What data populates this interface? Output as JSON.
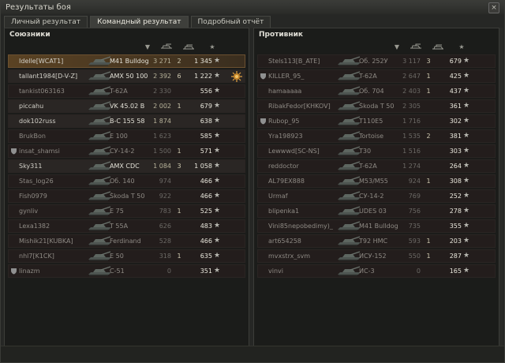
{
  "window": {
    "title": "Результаты боя",
    "close_label": "×"
  },
  "tabs": [
    {
      "label": "Личный результат"
    },
    {
      "label": "Командный результат"
    },
    {
      "label": "Подробный отчёт"
    }
  ],
  "allies": {
    "title": "Союзники",
    "rows": [
      {
        "name": "Idelle[WCAT1]",
        "tank": "M41 Bulldog",
        "damage": "3 271",
        "kills": "2",
        "xp": "1 345",
        "state": "me",
        "platoon": false
      },
      {
        "name": "tallant1984[D-V-Z]",
        "tank": "AMX 50 100",
        "damage": "2 392",
        "kills": "6",
        "xp": "1 222",
        "state": "alive",
        "platoon": false,
        "medal": true
      },
      {
        "name": "tankist063163",
        "tank": "T-62A",
        "damage": "2 330",
        "kills": "",
        "xp": "556",
        "state": "dead",
        "platoon": false
      },
      {
        "name": "piccahu",
        "tank": "VK 45.02 B",
        "damage": "2 002",
        "kills": "1",
        "xp": "679",
        "state": "alive",
        "platoon": false
      },
      {
        "name": "dok102russ",
        "tank": "B-C 155 58",
        "damage": "1 874",
        "kills": "",
        "xp": "638",
        "state": "alive",
        "platoon": false
      },
      {
        "name": "BrukBon",
        "tank": "E 100",
        "damage": "1 623",
        "kills": "",
        "xp": "585",
        "state": "dead",
        "platoon": false
      },
      {
        "name": "insat_shamsi",
        "tank": "СУ-14-2",
        "damage": "1 500",
        "kills": "1",
        "xp": "571",
        "state": "dead",
        "platoon": true
      },
      {
        "name": "Sky311",
        "tank": "AMX CDC",
        "damage": "1 084",
        "kills": "3",
        "xp": "1 058",
        "state": "alive",
        "platoon": false
      },
      {
        "name": "Stas_log26",
        "tank": "Об. 140",
        "damage": "974",
        "kills": "",
        "xp": "466",
        "state": "dead",
        "platoon": false
      },
      {
        "name": "Fish0979",
        "tank": "Škoda T 50",
        "damage": "922",
        "kills": "",
        "xp": "466",
        "state": "dead",
        "platoon": false
      },
      {
        "name": "gynliv",
        "tank": "E 75",
        "damage": "783",
        "kills": "1",
        "xp": "525",
        "state": "dead",
        "platoon": false
      },
      {
        "name": "Lexa1382",
        "tank": "T 55A",
        "damage": "626",
        "kills": "",
        "xp": "483",
        "state": "dead",
        "platoon": false
      },
      {
        "name": "Mishik21[KUBKA]",
        "tank": "Ferdinand",
        "damage": "528",
        "kills": "",
        "xp": "466",
        "state": "dead",
        "platoon": false
      },
      {
        "name": "nhl7[K1CK]",
        "tank": "E 50",
        "damage": "318",
        "kills": "1",
        "xp": "635",
        "state": "dead",
        "platoon": false
      },
      {
        "name": "Iinazm",
        "tank": "C-51",
        "damage": "0",
        "kills": "",
        "xp": "351",
        "state": "dead",
        "platoon": true
      }
    ]
  },
  "enemies": {
    "title": "Противник",
    "rows": [
      {
        "name": "Stels113[B_ATE]",
        "tank": "Об. 252У",
        "damage": "3 117",
        "kills": "3",
        "xp": "679",
        "state": "dead",
        "platoon": false
      },
      {
        "name": "KILLER_95_",
        "tank": "T-62A",
        "damage": "2 647",
        "kills": "1",
        "xp": "425",
        "state": "dead",
        "platoon": true
      },
      {
        "name": "hamaaaaa",
        "tank": "Об. 704",
        "damage": "2 403",
        "kills": "1",
        "xp": "437",
        "state": "dead",
        "platoon": false
      },
      {
        "name": "RibakFedor[KHKOV]",
        "tank": "Škoda T 50",
        "damage": "2 305",
        "kills": "",
        "xp": "361",
        "state": "dead",
        "platoon": false
      },
      {
        "name": "Rubop_95",
        "tank": "T110E5",
        "damage": "1 716",
        "kills": "",
        "xp": "302",
        "state": "dead",
        "platoon": true
      },
      {
        "name": "Yra198923",
        "tank": "Tortoise",
        "damage": "1 535",
        "kills": "2",
        "xp": "381",
        "state": "dead",
        "platoon": false
      },
      {
        "name": "Lewwwd[SC-NS]",
        "tank": "T30",
        "damage": "1 516",
        "kills": "",
        "xp": "303",
        "state": "dead",
        "platoon": false
      },
      {
        "name": "reddoctor",
        "tank": "T-62A",
        "damage": "1 274",
        "kills": "",
        "xp": "264",
        "state": "dead",
        "platoon": false
      },
      {
        "name": "AL79EX888",
        "tank": "M53/M55",
        "damage": "924",
        "kills": "1",
        "xp": "308",
        "state": "dead",
        "platoon": false
      },
      {
        "name": "Urmaf",
        "tank": "СУ-14-2",
        "damage": "769",
        "kills": "",
        "xp": "252",
        "state": "dead",
        "platoon": false
      },
      {
        "name": "blipenka1",
        "tank": "UDES 03",
        "damage": "756",
        "kills": "",
        "xp": "278",
        "state": "dead",
        "platoon": false
      },
      {
        "name": "Vini85nepobedimy)_",
        "tank": "M41 Bulldog",
        "damage": "735",
        "kills": "",
        "xp": "355",
        "state": "dead",
        "platoon": false
      },
      {
        "name": "art654258",
        "tank": "T92 HMC",
        "damage": "593",
        "kills": "1",
        "xp": "203",
        "state": "dead",
        "platoon": false
      },
      {
        "name": "mvxstrx_svm",
        "tank": "ИСУ-152",
        "damage": "550",
        "kills": "1",
        "xp": "287",
        "state": "dead",
        "platoon": false
      },
      {
        "name": "vinvi",
        "tank": "ИС-3",
        "damage": "0",
        "kills": "",
        "xp": "165",
        "state": "dead",
        "platoon": false
      }
    ]
  },
  "icons": {
    "star": "★",
    "platoon": "shield-icon",
    "sort": "▼"
  }
}
